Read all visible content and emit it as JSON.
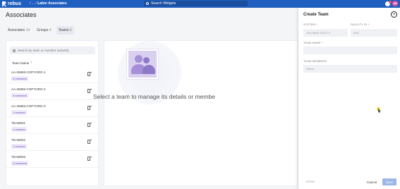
{
  "topbar": {
    "brand": "rebus",
    "breadcrumb_prefix": "/ ... /",
    "breadcrumb_current": "Labor Associates",
    "search_label": "Search Widgets",
    "notification_count": "1",
    "avatar_initials": "AM",
    "colors": {
      "bar": "#1f5fbf"
    }
  },
  "page": {
    "title": "Associates",
    "tabs": [
      {
        "label": "Associates",
        "count": "14"
      },
      {
        "label": "Groups",
        "count": "4"
      },
      {
        "label": "Teams",
        "count": "6"
      }
    ],
    "active_tab": "Teams"
  },
  "left_panel": {
    "search_placeholder": "Search by team or member name/ID",
    "column_header": "Team Name",
    "rows": [
      {
        "name": "AA-25993-COPYORG-1",
        "members": "0 members"
      },
      {
        "name": "AA-25993-COPYORG-2",
        "members": "0 members"
      },
      {
        "name": "AA-25993-COPYORG-3",
        "members": "1 member"
      },
      {
        "name": "TEAM001",
        "members": "1 member"
      },
      {
        "name": "TEAM002",
        "members": "1 member"
      },
      {
        "name": "TEAM003",
        "members": "4 members"
      }
    ]
  },
  "main": {
    "empty_message": "Select a team to manage its details or membe"
  },
  "drawer": {
    "title": "Create Team",
    "system_label": "SYSTEM",
    "system_value": "JDA WMS 2023.2.1",
    "facility_label": "FACILITY ID",
    "facility_value": "DSC",
    "team_name_label": "TEAM NAME",
    "team_name_value": "",
    "members_label": "TEAM MEMBERS",
    "members_placeholder": "Select",
    "reset_label": "Reset",
    "cancel_label": "Cancel",
    "save_label": "Save"
  },
  "icons": {
    "close": "close-icon",
    "search": "search-icon",
    "trash": "trash-icon",
    "sort": "arrow-up-icon"
  }
}
